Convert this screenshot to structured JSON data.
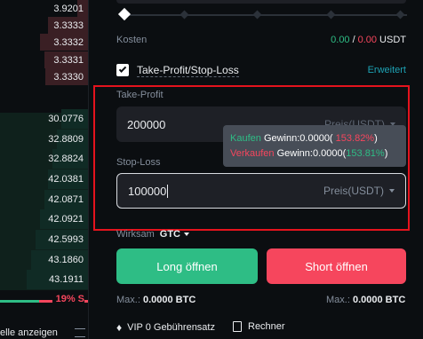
{
  "orderbook": {
    "asks": [
      {
        "price": "3.9201",
        "depth": 0.12
      },
      {
        "price": "3.3333",
        "depth": 0.45
      },
      {
        "price": "3.3332",
        "depth": 0.55
      },
      {
        "price": "3.3331",
        "depth": 0.5
      },
      {
        "price": "3.3330",
        "depth": 0.48
      }
    ],
    "bids": [
      {
        "price": "30.0776",
        "depth": 0.3
      },
      {
        "price": "32.8809",
        "depth": 0.35
      },
      {
        "price": "32.8824",
        "depth": 0.4
      },
      {
        "price": "42.0381",
        "depth": 0.45
      },
      {
        "price": "42.0871",
        "depth": 0.5
      },
      {
        "price": "42.0921",
        "depth": 0.55
      },
      {
        "price": "42.5993",
        "depth": 0.6
      },
      {
        "price": "43.1860",
        "depth": 0.65
      },
      {
        "price": "43.1911",
        "depth": 0.7
      }
    ],
    "ratio_label": "19% S",
    "ratio_sell_fraction": 0.19,
    "footer_label": "elle anzeigen"
  },
  "form": {
    "cost_label": "Kosten",
    "cost_long": "0.00",
    "cost_sep": "/",
    "cost_short": "0.00",
    "cost_unit": "USDT",
    "tpsl_label": "Take-Profit/Stop-Loss",
    "advanced_label": "Erweitert",
    "take_profit_label": "Take-Profit",
    "take_profit_value": "200000",
    "take_profit_unit": "Preis(USDT)",
    "stop_loss_label": "Stop-Loss",
    "stop_loss_value": "100000",
    "stop_loss_unit": "Preis(USDT)",
    "tif_label": "Wirksam",
    "tif_value": "GTC",
    "long_button": "Long öffnen",
    "short_button": "Short öffnen",
    "max_long_label": "Max.:",
    "max_long_value": "0.0000 BTC",
    "max_short_label": "Max.:",
    "max_short_value": "0.0000 BTC",
    "vip_label": "VIP 0 Gebührensatz",
    "calculator_label": "Rechner"
  },
  "tooltip": {
    "buy_label": "Kaufen",
    "buy_gain": "Gewinn:0.0000(",
    "buy_pct": " 153.82%",
    "buy_close": ")",
    "sell_label": "Verkaufen",
    "sell_gain": "Gewinn:0.0000(",
    "sell_pct": "153.81%",
    "sell_close": ")"
  },
  "colors": {
    "green": "#2ebd85",
    "red": "#f6465d",
    "highlight": "#e5131d",
    "link": "#1da2b4"
  }
}
